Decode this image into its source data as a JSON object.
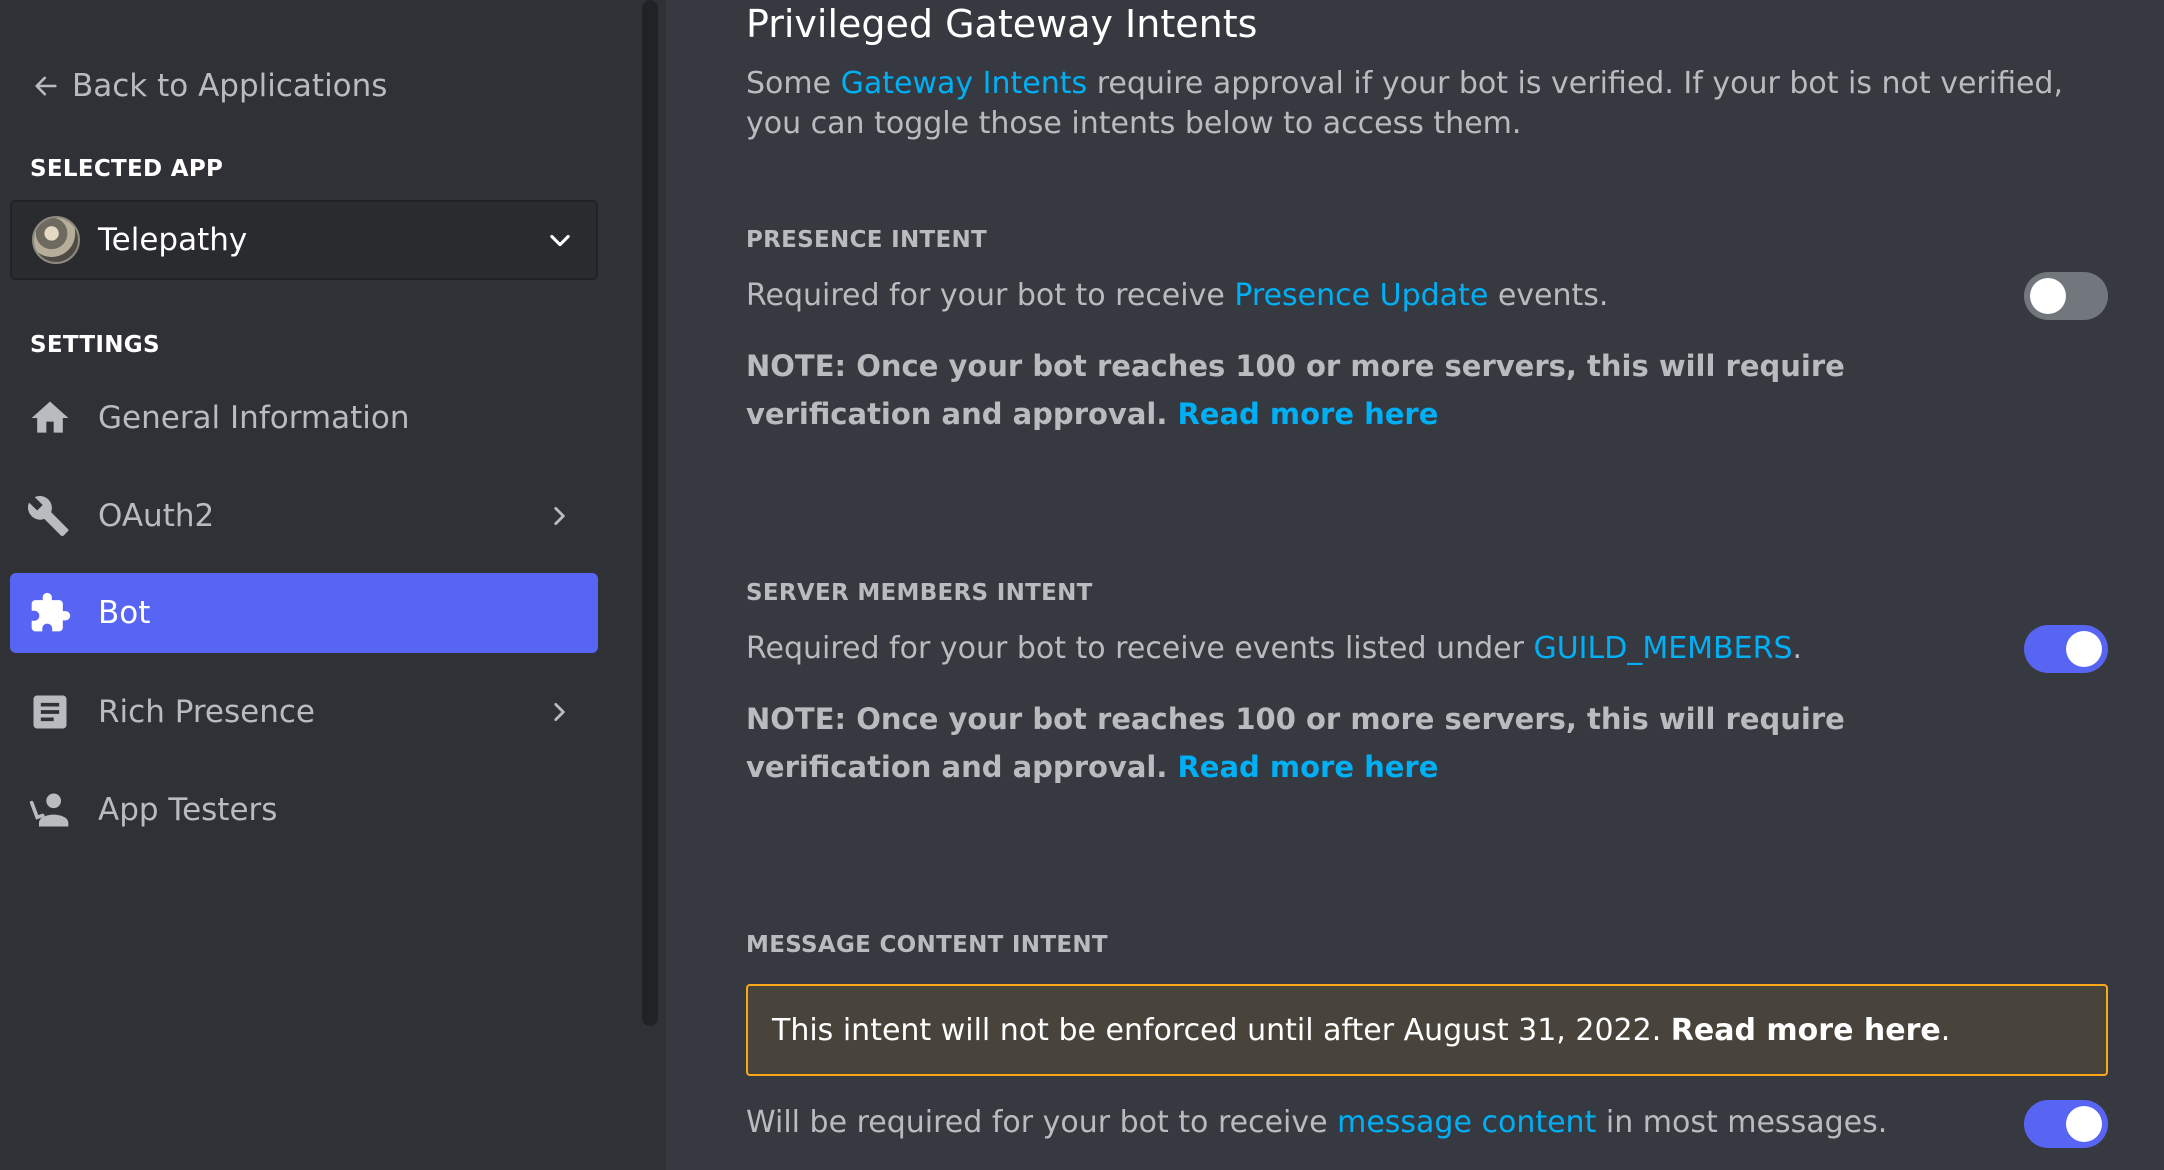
{
  "sidebar": {
    "back_label": "Back to Applications",
    "selected_app_heading": "SELECTED APP",
    "selected_app_name": "Telepathy",
    "settings_heading": "SETTINGS",
    "items": [
      {
        "label": "General Information",
        "icon": "home-icon",
        "has_chevron": false,
        "active": false
      },
      {
        "label": "OAuth2",
        "icon": "wrench-icon",
        "has_chevron": true,
        "active": false
      },
      {
        "label": "Bot",
        "icon": "puzzle-icon",
        "has_chevron": false,
        "active": true
      },
      {
        "label": "Rich Presence",
        "icon": "document-icon",
        "has_chevron": true,
        "active": false
      },
      {
        "label": "App Testers",
        "icon": "person-icon",
        "has_chevron": false,
        "active": false
      }
    ]
  },
  "main": {
    "title": "Privileged Gateway Intents",
    "desc": {
      "before": "Some ",
      "link": "Gateway Intents",
      "after": " require approval if your bot is verified. If your bot is not verified, you can toggle those intents below to access them."
    },
    "presence": {
      "label": "PRESENCE INTENT",
      "text_before": "Required for your bot to receive ",
      "link": "Presence Update",
      "text_after": " events.",
      "note_text": "NOTE: Once your bot reaches 100 or more servers, this will require verification and approval.",
      "note_link": "Read more here",
      "enabled": false
    },
    "members": {
      "label": "SERVER MEMBERS INTENT",
      "text_before": "Required for your bot to receive events listed under ",
      "link": "GUILD_MEMBERS",
      "text_after": ".",
      "note_text": "NOTE: Once your bot reaches 100 or more servers, this will require verification and approval.",
      "note_link": "Read more here",
      "enabled": true
    },
    "message": {
      "label": "MESSAGE CONTENT INTENT",
      "warning_text": "This intent will not be enforced until after August 31, 2022.",
      "warning_link": "Read more here",
      "warning_end": ".",
      "text_before": "Will be required for your bot to receive ",
      "link": "message content",
      "text_after": " in most messages.",
      "enabled": true
    }
  },
  "colors": {
    "accent": "#5865f2",
    "link": "#00aff4",
    "warning_border": "#faa81a"
  }
}
